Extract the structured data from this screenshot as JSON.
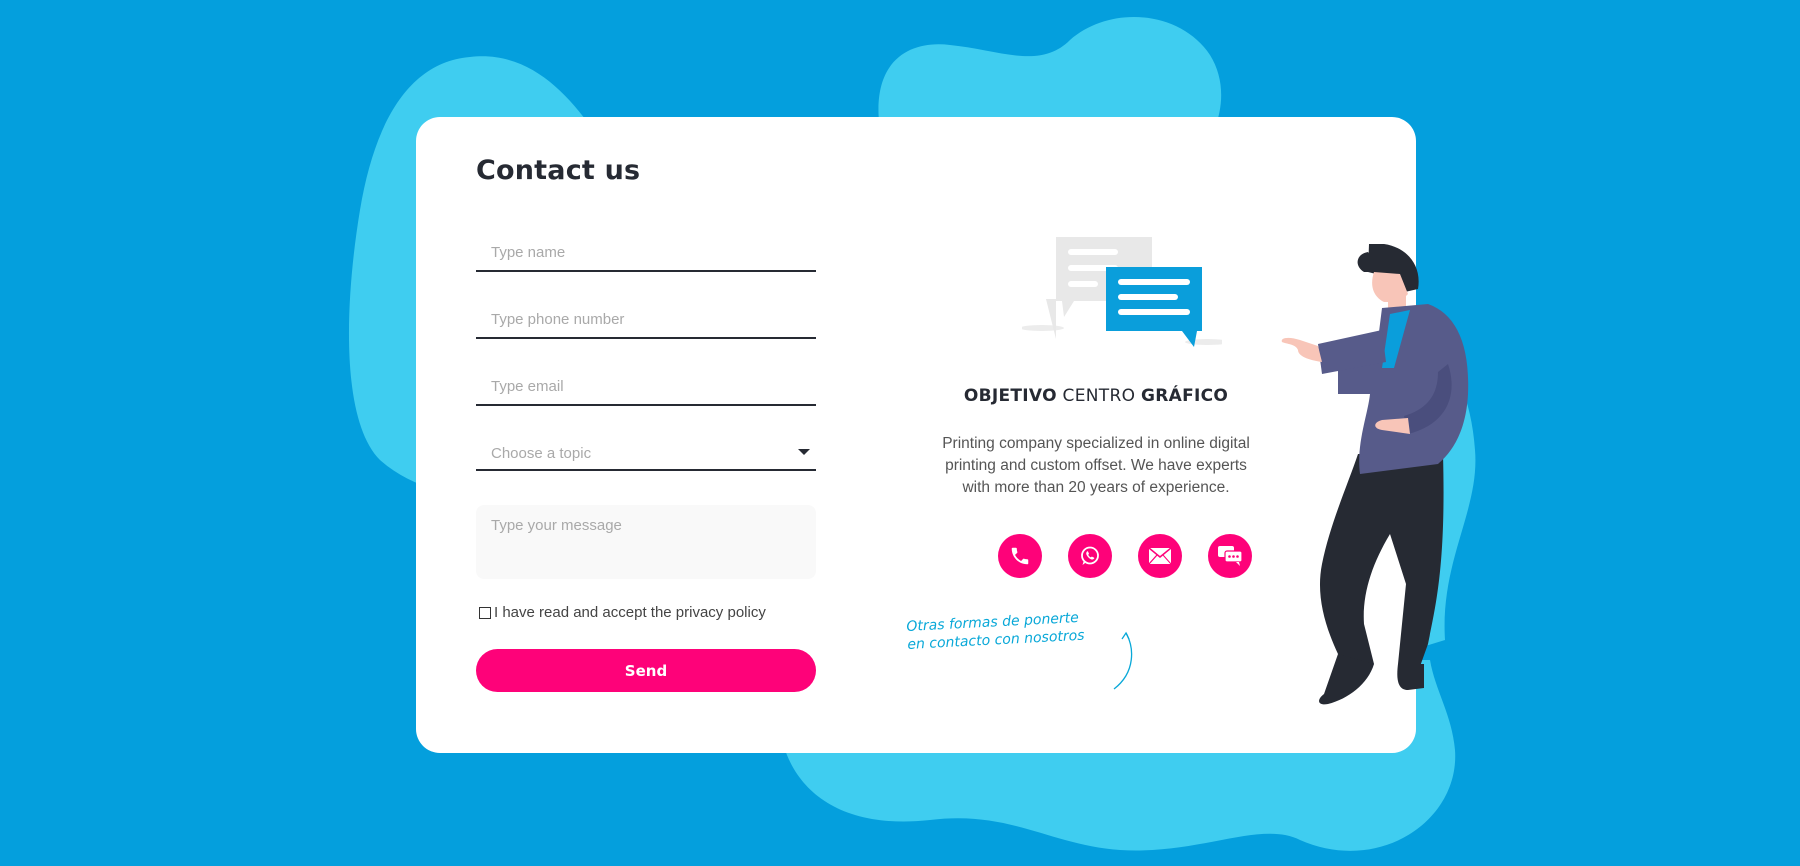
{
  "form": {
    "title": "Contact us",
    "name_placeholder": "Type name",
    "phone_placeholder": "Type phone number",
    "email_placeholder": "Type email",
    "topic_placeholder": "Choose a topic",
    "message_placeholder": "Type your message",
    "privacy_label": "I have read and accept the privacy policy",
    "send_label": "Send"
  },
  "info": {
    "brand_bold_1": "OBJETIVO",
    "brand_regular": "CENTRO",
    "brand_bold_2": "GRÁFICO",
    "description": "Printing company specialized in online digital printing and custom offset. We have experts with more than 20 years of experience.",
    "contact_icons": [
      "phone-icon",
      "whatsapp-icon",
      "email-icon",
      "chat-icon"
    ],
    "note_line1": "Otras formas de ponerte",
    "note_line2": "en contacto con nosotros"
  },
  "colors": {
    "background": "#049fdd",
    "blob": "#3fcdf0",
    "card": "#ffffff",
    "accent": "#fe0279",
    "text_dark": "#262a33",
    "note": "#09a8d8"
  }
}
